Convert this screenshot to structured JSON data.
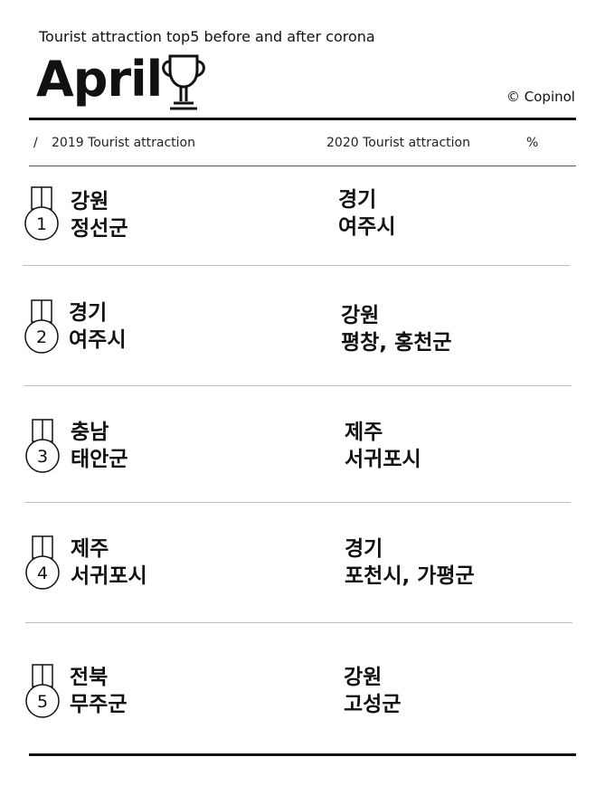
{
  "header": {
    "subtitle": "Tourist attraction top5 before and after corona",
    "title": "April",
    "copyright": "© Copinol"
  },
  "columns": {
    "slash": "/",
    "col_2019": "2019 Tourist attraction",
    "col_2020": "2020 Tourist attraction",
    "col_pct": "%"
  },
  "rows": [
    {
      "rank": "1",
      "y2019": [
        "강원",
        "정선군"
      ],
      "y2020": [
        "경기",
        "여주시"
      ]
    },
    {
      "rank": "2",
      "y2019": [
        "경기",
        "여주시"
      ],
      "y2020": [
        "강원",
        "평창, 홍천군"
      ]
    },
    {
      "rank": "3",
      "y2019": [
        "충남",
        "태안군"
      ],
      "y2020": [
        "제주",
        "서귀포시"
      ]
    },
    {
      "rank": "4",
      "y2019": [
        "제주",
        "서귀포시"
      ],
      "y2020": [
        "경기",
        "포천시, 가평군"
      ]
    },
    {
      "rank": "5",
      "y2019": [
        "전북",
        "무주군"
      ],
      "y2020": [
        "강원",
        "고성군"
      ]
    }
  ]
}
